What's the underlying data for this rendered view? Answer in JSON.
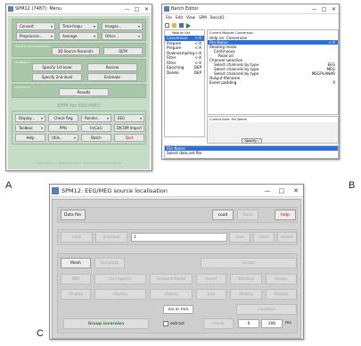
{
  "panels": {
    "a": "A",
    "b": "B",
    "c": "C"
  },
  "spm_menu": {
    "title": "SPM12 (7487): Menu",
    "row1": [
      "Convert",
      "Time-frequ",
      "Images..."
    ],
    "row2": [
      "Preprocess...",
      "Average",
      "Other..."
    ],
    "group_source": "Source reconstruction",
    "group_stats": "Statistics",
    "group_inference": "Inference",
    "sr_label": "3D Source Reconstr.",
    "dcm_label": "DCM",
    "specify1_label": "Specify 1st-level",
    "review_label": "Review",
    "specify2_label": "Specify 2nd-level",
    "estimate_label": "Estimate",
    "results_label": "Results",
    "banner": "SPM for EEG/MEG",
    "row_a": [
      "Display...",
      "Check Reg",
      "Render...",
      "EEG"
    ],
    "row_b": [
      "Toolbox:",
      "PPIs",
      "ImCalc",
      "DICOM Import"
    ],
    "row_c": [
      "Help",
      "Utils...",
      "Batch",
      "Quit"
    ],
    "footer": "Copyright (c) Wellcome Trust Centre for Neuroimaging"
  },
  "batch_editor": {
    "title": "Batch Editor",
    "menu": [
      "File",
      "Edit",
      "View",
      "SPM",
      "BasicIO"
    ],
    "module_list_header": "Module List",
    "modules": [
      {
        "name": "Conversion",
        "mark": "<-X",
        "selected": true
      },
      {
        "name": "Prepare",
        "mark": "<-X",
        "selected": false
      },
      {
        "name": "Prepare",
        "mark": "<-X",
        "selected": false
      },
      {
        "name": "Downsampling",
        "mark": "<-X",
        "selected": false
      },
      {
        "name": "Filter",
        "mark": "<-X",
        "selected": false
      },
      {
        "name": "Filter",
        "mark": "<-X",
        "selected": false
      },
      {
        "name": "Epoching",
        "mark": "DEP",
        "selected": false
      },
      {
        "name": "Delete",
        "mark": "DEP",
        "selected": false
      }
    ],
    "current_module_header": "Current Module: Conversion",
    "current_items": [
      {
        "label": "Help on: Conversion",
        "value": "",
        "indent": 0,
        "selected": false
      },
      {
        "label": "File Name",
        "value": "<-X",
        "indent": 0,
        "selected": true
      },
      {
        "label": "Reading mode",
        "value": "",
        "indent": 0,
        "selected": false
      },
      {
        "label": "Continuous",
        "value": "",
        "indent": 1,
        "selected": false
      },
      {
        "label": "Read all",
        "value": "",
        "indent": 2,
        "selected": false
      },
      {
        "label": "Channel selection",
        "value": "",
        "indent": 0,
        "selected": false
      },
      {
        "label": "Select channels by type",
        "value": "EEG",
        "indent": 1,
        "selected": false
      },
      {
        "label": "Select channels by type",
        "value": "MEG",
        "indent": 1,
        "selected": false
      },
      {
        "label": "Select channels by type",
        "value": "MEGPLANAR",
        "indent": 1,
        "selected": false
      },
      {
        "label": "Output filename",
        "value": "",
        "indent": 0,
        "selected": false
      },
      {
        "label": "Event padding",
        "value": "0",
        "indent": 0,
        "selected": false
      }
    ],
    "current_item_header": "Current Item: File Name",
    "specify_label": "Specify...",
    "help_lines": [
      {
        "text": "File Name",
        "selected": true
      },
      {
        "text": "Select data set file.",
        "selected": false
      }
    ]
  },
  "source_loc": {
    "title": "SPM12: EEG/MEG source localisation",
    "data_file_label": "Data file",
    "load_label": "Load",
    "save_label": "Save",
    "help_label": "help",
    "prev_label": "previous",
    "next_label": "next",
    "model_value": "1",
    "new_label": "new",
    "clear_label": "clear",
    "delete_label": "delete",
    "mesh_label": "Mesh",
    "template_label": "template",
    "render_label": "render",
    "mri_label": "MRI",
    "coreg_label": "Co-register",
    "forward_label": "Forward Model",
    "invert_label": "Invert",
    "window_label": "Window",
    "image_label": "Image",
    "display_label": "display",
    "mip_label": "mip",
    "ms_or_mm_label": "ms or mm",
    "condition_label": "condition",
    "group_inversion_label": "Group inversion",
    "extract_label": "extract",
    "movie_label": "movie",
    "movie_from": "0",
    "movie_to": "300",
    "ms_label": "ms"
  },
  "colors": {
    "spm_green": "#a9c8a9",
    "quit_red": "#b00000",
    "selection_blue": "#2c6fd6",
    "group_green": "#2e7d32"
  }
}
